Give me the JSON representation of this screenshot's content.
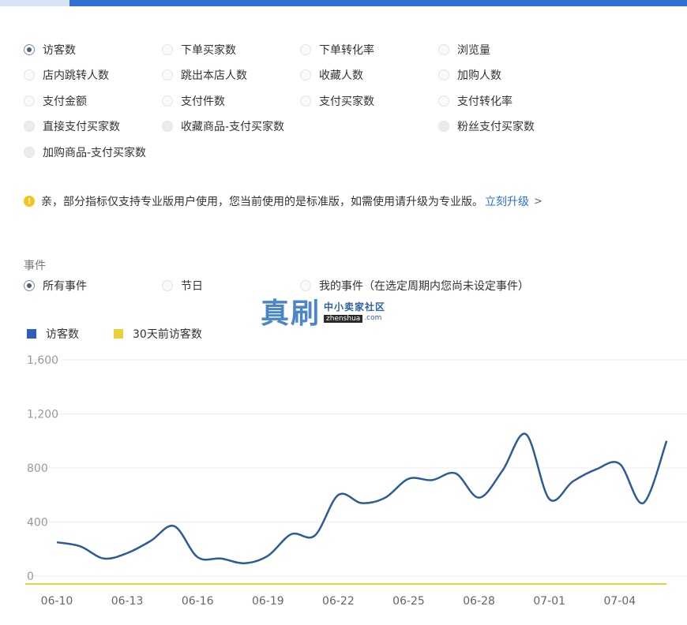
{
  "metrics": [
    {
      "label": "访客数",
      "checked": true,
      "disabled": false
    },
    {
      "label": "下单买家数",
      "checked": false,
      "disabled": false
    },
    {
      "label": "下单转化率",
      "checked": false,
      "disabled": false
    },
    {
      "label": "浏览量",
      "checked": false,
      "disabled": false
    },
    {
      "label": "店内跳转人数",
      "checked": false,
      "disabled": false
    },
    {
      "label": "跳出本店人数",
      "checked": false,
      "disabled": false
    },
    {
      "label": "收藏人数",
      "checked": false,
      "disabled": false
    },
    {
      "label": "加购人数",
      "checked": false,
      "disabled": false
    },
    {
      "label": "支付金额",
      "checked": false,
      "disabled": false
    },
    {
      "label": "支付件数",
      "checked": false,
      "disabled": false
    },
    {
      "label": "支付买家数",
      "checked": false,
      "disabled": false
    },
    {
      "label": "支付转化率",
      "checked": false,
      "disabled": false
    },
    {
      "label": "直接支付买家数",
      "checked": false,
      "disabled": true
    },
    {
      "label": "收藏商品-支付买家数",
      "checked": false,
      "disabled": true
    },
    {
      "label": "粉丝支付买家数",
      "checked": false,
      "disabled": true
    },
    {
      "label": "加购商品-支付买家数",
      "checked": false,
      "disabled": true
    }
  ],
  "notice": {
    "text": "亲，部分指标仅支持专业版用户使用，您当前使用的是标准版，如需使用请升级为专业版。",
    "link": "立刻升级",
    "chevron": ">"
  },
  "events": {
    "label": "事件",
    "options": [
      {
        "label": "所有事件",
        "checked": true
      },
      {
        "label": "节日",
        "checked": false
      },
      {
        "label": "我的事件（在选定周期内您尚未设定事件）",
        "checked": false
      }
    ]
  },
  "watermark": {
    "big": "真刷",
    "cn": "中小卖家社区",
    "url": "zhenshua",
    ".com": ".com"
  },
  "legend": [
    {
      "label": "访客数",
      "color": "#2e5fb8"
    },
    {
      "label": "30天前访客数",
      "color": "#e8d23a"
    }
  ],
  "chart_data": {
    "type": "line",
    "x": [
      "06-10",
      "06-11",
      "06-12",
      "06-13",
      "06-14",
      "06-15",
      "06-16",
      "06-17",
      "06-18",
      "06-19",
      "06-20",
      "06-21",
      "06-22",
      "06-23",
      "06-24",
      "06-25",
      "06-26",
      "06-27",
      "06-28",
      "06-29",
      "06-30",
      "07-01",
      "07-02",
      "07-03",
      "07-04",
      "07-05",
      "07-06"
    ],
    "tick_labels": [
      "06-10",
      "06-13",
      "06-16",
      "06-19",
      "06-22",
      "06-25",
      "06-28",
      "07-01",
      "07-04"
    ],
    "y_ticks": [
      "1,600",
      "1,200",
      "800",
      "400",
      "0"
    ],
    "ylim": [
      0,
      1600
    ],
    "grid": true,
    "series": [
      {
        "name": "访客数",
        "color": "#2b5c96",
        "values": [
          250,
          220,
          130,
          170,
          260,
          370,
          140,
          130,
          95,
          150,
          310,
          300,
          600,
          540,
          580,
          720,
          710,
          760,
          580,
          780,
          1050,
          570,
          700,
          790,
          830,
          540,
          1000
        ]
      },
      {
        "name": "30天前访客数",
        "color": "#e8d23a",
        "values": [
          0,
          0,
          0,
          0,
          0,
          0,
          0,
          0,
          0,
          0,
          0,
          0,
          0,
          0,
          0,
          0,
          0,
          0,
          0,
          0,
          0,
          0,
          0,
          0,
          0,
          0,
          0
        ]
      }
    ]
  }
}
